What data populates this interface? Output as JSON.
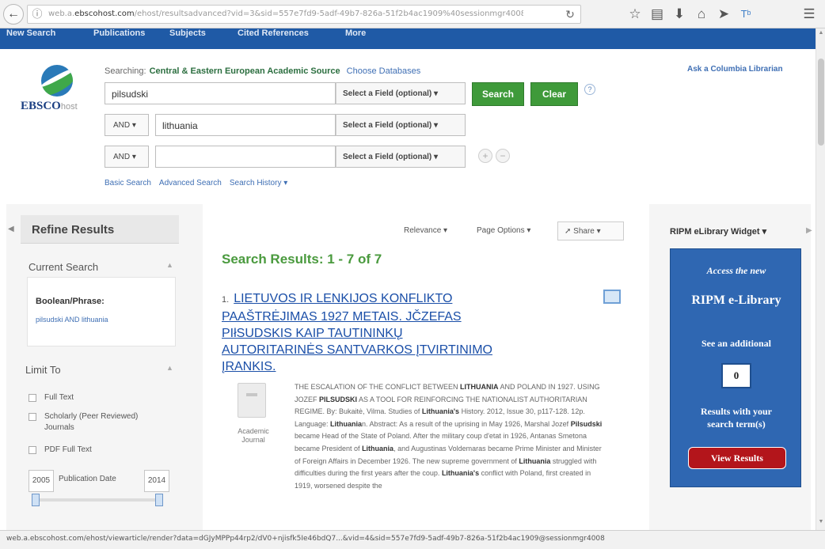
{
  "browser": {
    "back_icon": "back-arrow-icon",
    "info_icon": "info-icon",
    "url_prefix": "web.a.",
    "url_domain": "ebscohost.com",
    "url_rest": "/ehost/resultsadvanced?vid=3&sid=557e7fd9-5adf-49b7-826a-51f2b4ac1909%40sessionmgr4008",
    "reload_icon": "reload-icon",
    "toolbar_icons": [
      "star-icon",
      "clipboard-icon",
      "download-icon",
      "home-icon",
      "send-icon",
      "translate-icon",
      "menu-icon"
    ]
  },
  "nav": {
    "items": [
      "New Search",
      "Publications",
      "Subjects",
      "Cited References",
      "More"
    ]
  },
  "logo": {
    "brand": "EBSCO",
    "suffix": "host"
  },
  "search": {
    "searching_label": "Searching:",
    "database": "Central & Eastern European Academic Source",
    "choose_databases": "Choose Databases",
    "ask_librarian": "Ask a Columbia Librarian",
    "rows": [
      {
        "bool": "",
        "term": "pilsudski",
        "field": "Select a Field (optional) ▾"
      },
      {
        "bool": "AND ▾",
        "term": "lithuania",
        "field": "Select a Field (optional) ▾"
      },
      {
        "bool": "AND ▾",
        "term": "",
        "field": "Select a Field (optional) ▾"
      }
    ],
    "search_button": "Search",
    "clear_button": "Clear",
    "help": "?",
    "add": "+",
    "remove": "−",
    "links": [
      "Basic Search",
      "Advanced Search",
      "Search History ▾"
    ]
  },
  "refine": {
    "title": "Refine Results",
    "current_search": "Current Search",
    "boolean_label": "Boolean/Phrase:",
    "boolean_terms": "pilsudski AND lithuania",
    "limit_to": "Limit To",
    "limits": [
      "Full Text",
      "Scholarly (Peer Reviewed)",
      "Journals",
      "PDF Full Text"
    ],
    "date_from": "2005",
    "date_label": "Publication Date",
    "date_to": "2014"
  },
  "results": {
    "relevance": "Relevance ▾",
    "page_options": "Page Options ▾",
    "share": "Share ▾",
    "heading": "Search Results:",
    "heading_range": "1 - 7 of 7",
    "items": [
      {
        "number": "1.",
        "title_lines": [
          "LIETUVOS IR LENKIJOS KONFLIKTO",
          "PAAŠTRĖJIMAS 1927 METAIS. JČZEFAS",
          "PIłSUDSKIS KAIP TAUTININKŲ",
          "AUTORITARINĖS SANTVARKOS ĮTVIRTINIMO",
          "ĮRANKIS."
        ],
        "pub_type": "Academic Journal",
        "abstract": "THE ESCALATION OF THE CONFLICT BETWEEN LITHUANIA AND POLAND IN 1927. USING JOZEF PILSUDSKI AS A TOOL FOR REINFORCING THE NATIONALIST AUTHORITARIAN REGIME. By: Bukaitė, Vilma. Studies of Lithuania's History. 2012, Issue 30, p117-128. 12p. Language: Lithuanian. Abstract: As a result of the uprising in May 1926, Marshal Jozef Pilsudski became Head of the State of Poland. After the military coup d'etat in 1926, Antanas Smetona became President of Lithuania, and Augustinas Voldemaras became Prime Minister and Minister of Foreign Affairs in December 1926. The new supreme government of Lithuania struggled with difficulties during the first years after the coup. Lithuania's conflict with Poland, first created in 1919, worsened despite the"
      }
    ]
  },
  "widget": {
    "title": "RIPM eLibrary Widget ▾",
    "line1": "Access the new",
    "line2": "RIPM e-Library",
    "line3": "See an additional",
    "count": "0",
    "line4": "Results with your",
    "line5": "search term(s)",
    "button": "View Results"
  },
  "status": {
    "text": "web.a.ebscohost.com/ehost/viewarticle/render?data=dGJyMPPp44rp2/dV0+njisfk5Ie46bdQ7...&vid=4&sid=557e7fd9-5adf-49b7-826a-51f2b4ac1909@sessionmgr4008"
  },
  "colors": {
    "nav_blue": "#1f5aa6",
    "green_button": "#3f9a3a",
    "results_green": "#4a9a3e",
    "link_blue": "#1b4fa8",
    "ripm_blue": "#2f67b2",
    "ripm_red": "#b3151b"
  }
}
